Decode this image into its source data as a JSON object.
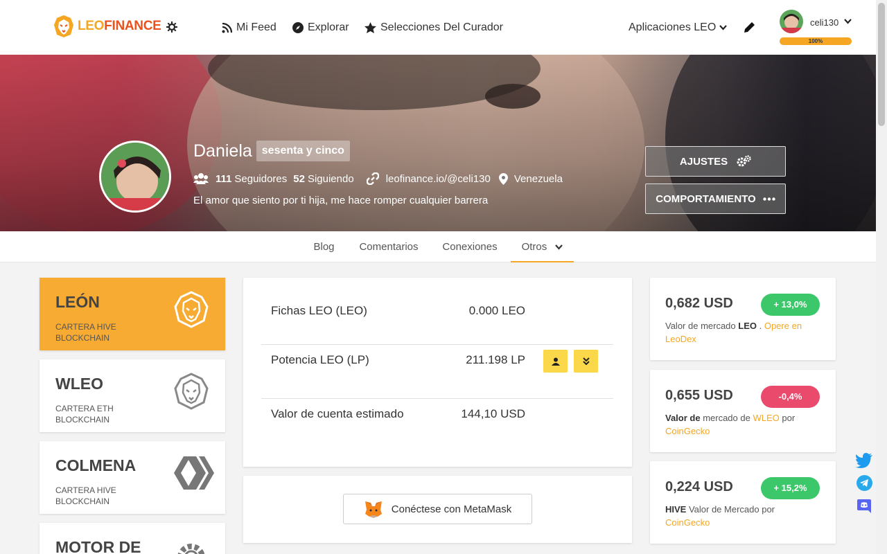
{
  "header": {
    "logo_leo": "LEO",
    "logo_finance": "FINANCE",
    "nav": [
      "Mi Feed",
      "Explorar",
      "Selecciones Del Curador"
    ],
    "apps_label": "Aplicaciones LEO",
    "username": "celi130",
    "voting_power": "100%",
    "voting_power_value": 100
  },
  "profile": {
    "name": "Daniela",
    "reputation": "sesenta y cinco",
    "followers_count": "111",
    "followers_label": "Seguidores",
    "following_count": "52",
    "following_label": "Siguiendo",
    "website": "leofinance.io/@celi130",
    "location": "Venezuela",
    "about": "El amor que siento por ti hija, me hace romper cualquier barrera",
    "settings_button": "AJUSTES",
    "behavior_button": "COMPORTAMIENTO"
  },
  "tabs": [
    "Blog",
    "Comentarios",
    "Conexiones",
    "Otros"
  ],
  "side_cards": [
    {
      "title": "LEÓN",
      "sub": "CARTERA HIVE BLOCKCHAIN"
    },
    {
      "title": "WLEO",
      "sub": "CARTERA ETH BLOCKCHAIN"
    },
    {
      "title": "COLMENA",
      "sub": "CARTERA HIVE BLOCKCHAIN"
    },
    {
      "title": "MOTOR DE",
      "sub": ""
    }
  ],
  "wallet": {
    "rows": [
      {
        "label": "Fichas LEO (LEO)",
        "value": "0.000 LEO"
      },
      {
        "label": "Potencia LEO (LP)",
        "value": "211.198 LP"
      },
      {
        "label": "Valor de cuenta estimado",
        "value": "144,10 USD"
      }
    ],
    "metamask_label": "Conéctese con MetaMask"
  },
  "prices": [
    {
      "value": "0,682 USD",
      "change": "+ 13,0%",
      "d1": "Valor de mercado ",
      "d2": "LEO",
      "d3": " . ",
      "d4": "Opere en LeoDex",
      "d5": ""
    },
    {
      "value": "0,655 USD",
      "change": "-0,4%",
      "d1": "",
      "d2": "Valor de",
      "d3": " mercado de ",
      "d4": "WLEO",
      "d5": " por ",
      "d6": "CoinGecko"
    },
    {
      "value": "0,224 USD",
      "change": "+ 15,2%",
      "d1": "",
      "d2": "HIVE",
      "d3": " Valor de Mercado por ",
      "d4": "CoinGecko",
      "d5": ""
    }
  ],
  "colors": {
    "accent": "#f5a623",
    "up": "#3cc86a",
    "down": "#ea4a6c",
    "button": "#fbd849"
  }
}
